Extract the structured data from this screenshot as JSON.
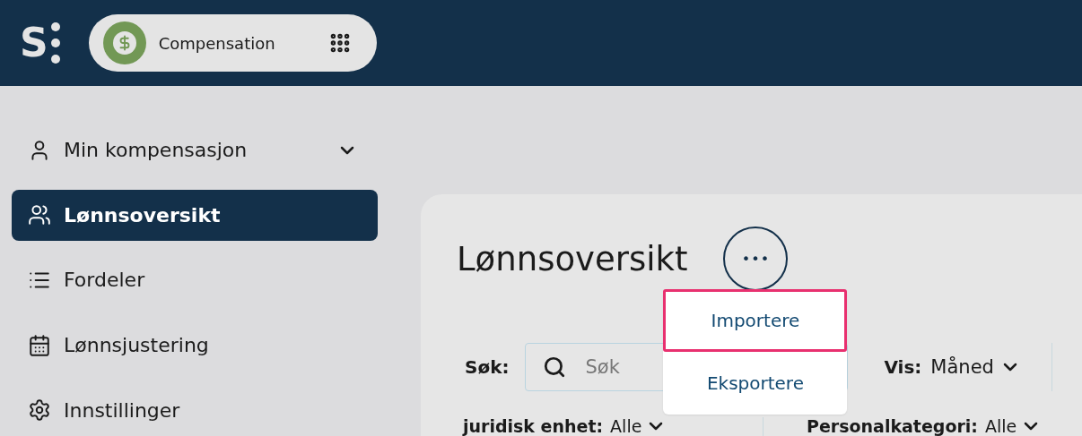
{
  "header": {
    "logo_letter": "S",
    "app_switcher": {
      "label": "Compensation"
    }
  },
  "sidebar": {
    "items": [
      {
        "label": "Min kompensasjon",
        "expandable": true,
        "selected": false
      },
      {
        "label": "Lønnsoversikt",
        "expandable": false,
        "selected": true
      },
      {
        "label": "Fordeler",
        "expandable": false,
        "selected": false
      },
      {
        "label": "Lønnsjustering",
        "expandable": false,
        "selected": false
      },
      {
        "label": "Innstillinger",
        "expandable": false,
        "selected": false
      }
    ]
  },
  "content": {
    "title": "Lønnsoversikt",
    "more_button": {
      "label": "•••",
      "expanded": true
    },
    "menu": [
      {
        "label": "Importere",
        "selected": true
      },
      {
        "label": "Eksportere",
        "selected": false
      }
    ],
    "search": {
      "label": "Søk:",
      "placeholder": "Søk"
    },
    "view": {
      "label": "Vis:",
      "value": "Måned"
    },
    "filters": [
      {
        "label": "juridisk enhet:",
        "value": "Alle"
      },
      {
        "label": "Personalkategori:",
        "value": "Alle"
      }
    ]
  }
}
